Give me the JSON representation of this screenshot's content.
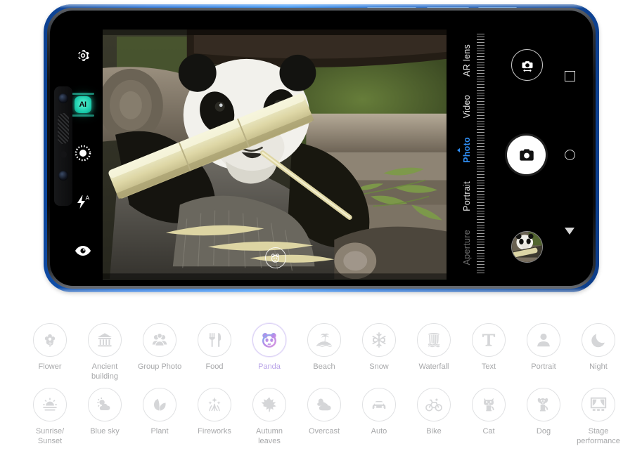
{
  "device": {
    "name": "smartphone-landscape",
    "frame_color": "#1668d8",
    "body_color": "#0a0a0b"
  },
  "camera_ui": {
    "left_toolbar": [
      {
        "name": "settings",
        "icon": "gear-icon",
        "label": "Settings"
      },
      {
        "name": "ai_scene",
        "icon": "ai-badge-icon",
        "label": "AI",
        "color": "#2de6c3",
        "state": "on"
      },
      {
        "name": "filter",
        "icon": "aperture-icon",
        "label": "Filters"
      },
      {
        "name": "flash",
        "icon": "flash-auto-icon",
        "label": "Flash auto"
      },
      {
        "name": "beauty",
        "icon": "eye-icon",
        "label": "Beauty"
      }
    ],
    "modes": [
      {
        "label": "Aperture",
        "active": false,
        "dim": true
      },
      {
        "label": "Portrait",
        "active": false,
        "dim": false
      },
      {
        "label": "Photo",
        "active": true,
        "dim": false
      },
      {
        "label": "Video",
        "active": false,
        "dim": false
      },
      {
        "label": "AR lens",
        "active": false,
        "dim": false
      }
    ],
    "active_mode": "Photo",
    "active_mode_color": "#2f8ef4",
    "controls": {
      "flip_camera": "switch-camera-icon",
      "shutter": "shutter-camera-icon",
      "gallery_thumbnail": "last-photo-thumbnail"
    },
    "nav_bar": [
      {
        "name": "recents",
        "icon": "square-icon"
      },
      {
        "name": "home",
        "icon": "circle-icon"
      },
      {
        "name": "back",
        "icon": "triangle-icon"
      }
    ],
    "viewfinder": {
      "subject": "giant panda eating bamboo",
      "focus_indicator": "panda-scene-icon"
    }
  },
  "scene_grid": {
    "rows": [
      [
        {
          "label": "Flower",
          "icon": "flower-icon",
          "active": false
        },
        {
          "label": "Ancient\nbuilding",
          "icon": "ancient-building-icon",
          "active": false
        },
        {
          "label": "Group Photo",
          "icon": "group-photo-icon",
          "active": false
        },
        {
          "label": "Food",
          "icon": "food-icon",
          "active": false
        },
        {
          "label": "Panda",
          "icon": "panda-icon",
          "active": true
        },
        {
          "label": "Beach",
          "icon": "beach-icon",
          "active": false
        },
        {
          "label": "Snow",
          "icon": "snow-icon",
          "active": false
        },
        {
          "label": "Waterfall",
          "icon": "waterfall-icon",
          "active": false
        },
        {
          "label": "Text",
          "icon": "text-icon",
          "active": false
        },
        {
          "label": "Portrait",
          "icon": "portrait-icon",
          "active": false
        },
        {
          "label": "Night",
          "icon": "night-icon",
          "active": false
        }
      ],
      [
        {
          "label": "Sunrise/\nSunset",
          "icon": "sunrise-sunset-icon",
          "active": false
        },
        {
          "label": "Blue sky",
          "icon": "blue-sky-icon",
          "active": false
        },
        {
          "label": "Plant",
          "icon": "plant-icon",
          "active": false
        },
        {
          "label": "Fireworks",
          "icon": "fireworks-icon",
          "active": false
        },
        {
          "label": "Autumn\nleaves",
          "icon": "autumn-leaves-icon",
          "active": false
        },
        {
          "label": "Overcast",
          "icon": "overcast-icon",
          "active": false
        },
        {
          "label": "Auto",
          "icon": "auto-car-icon",
          "active": false
        },
        {
          "label": "Bike",
          "icon": "bike-icon",
          "active": false
        },
        {
          "label": "Cat",
          "icon": "cat-icon",
          "active": false
        },
        {
          "label": "Dog",
          "icon": "dog-icon",
          "active": false
        },
        {
          "label": "Stage\nperformance",
          "icon": "stage-performance-icon",
          "active": false
        }
      ]
    ],
    "icon_color": "#d5d6d8",
    "label_color": "#a7a8aa",
    "active_color": "#b39ae8"
  }
}
